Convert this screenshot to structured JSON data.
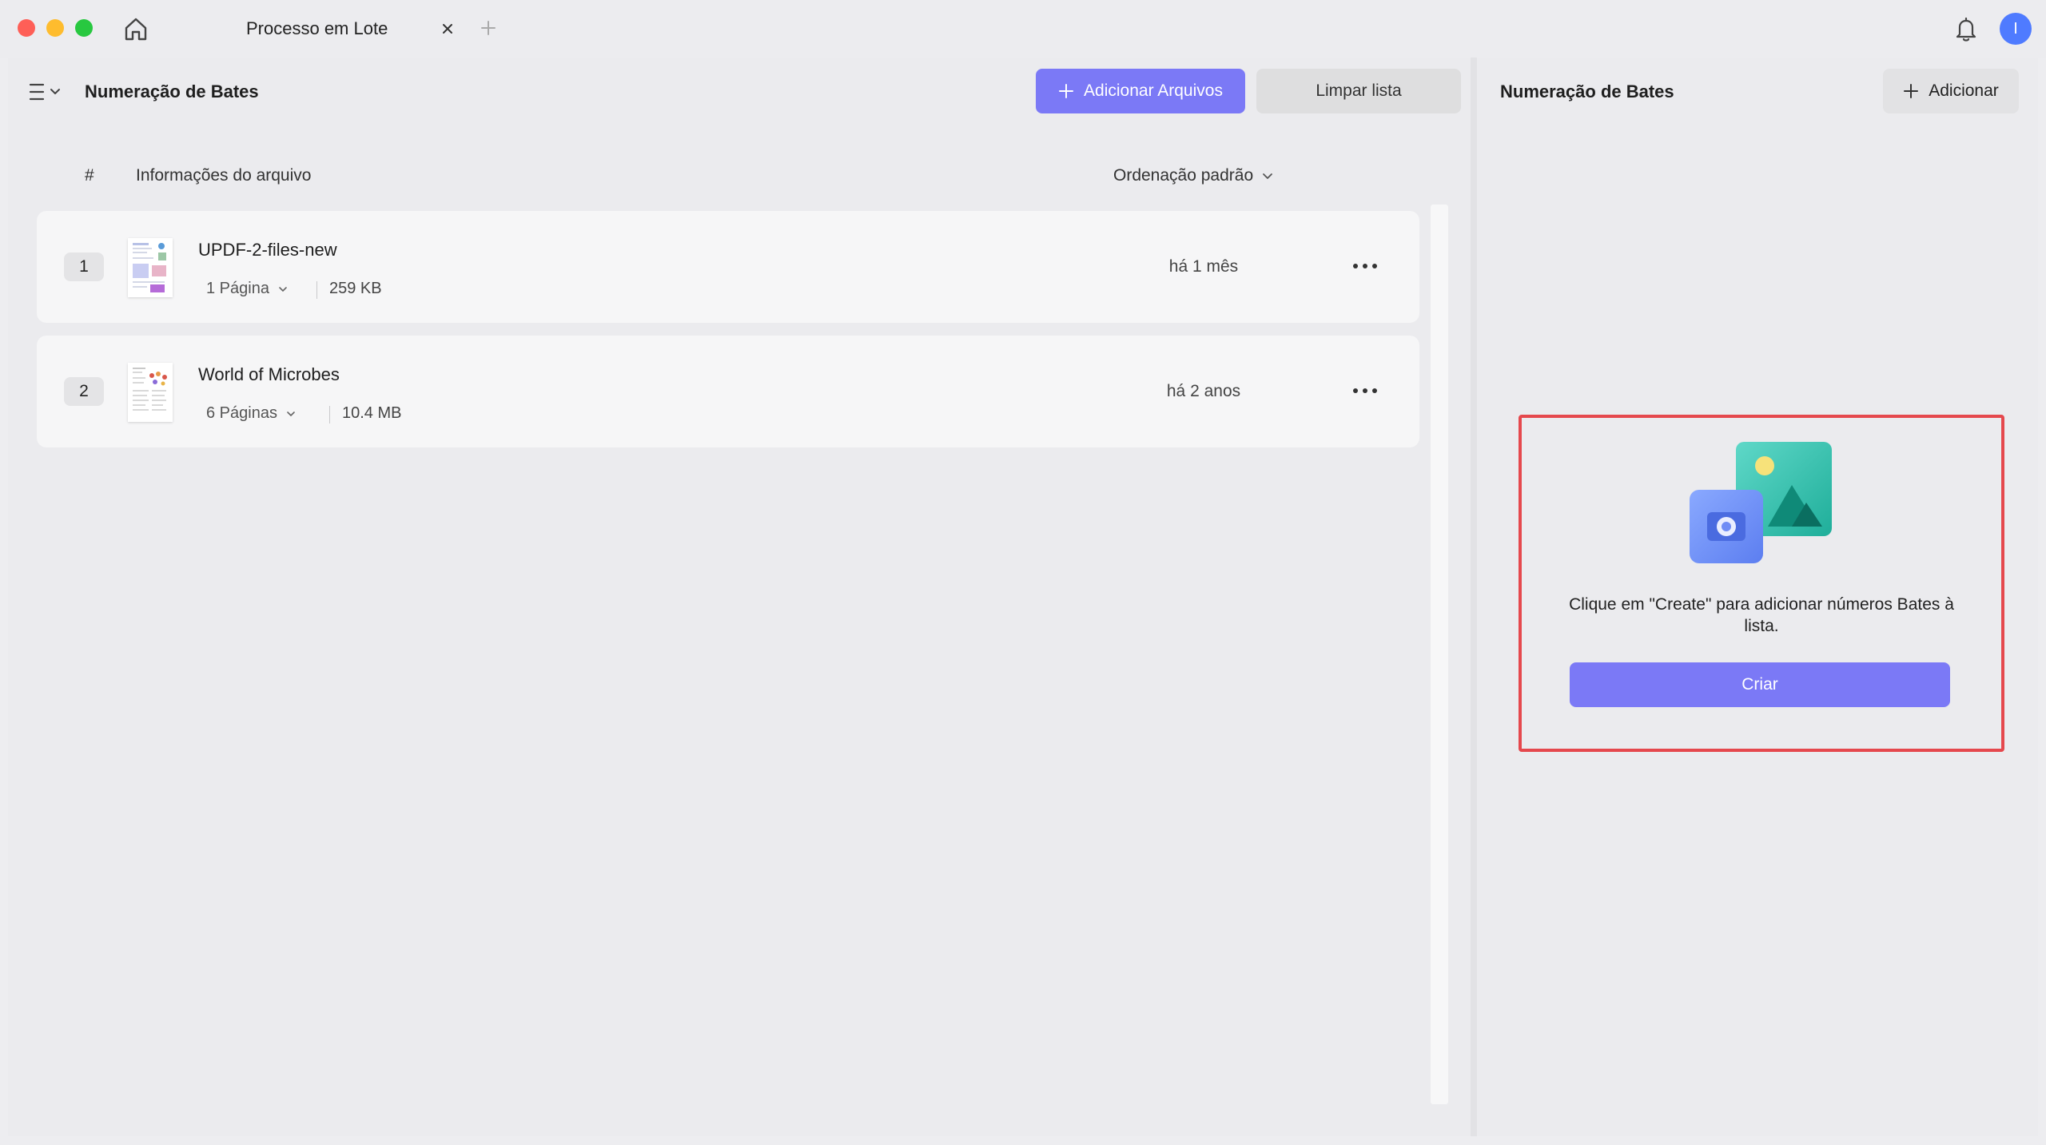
{
  "window": {
    "tab_title": "Processo em Lote",
    "avatar_initial": "I"
  },
  "left": {
    "title": "Numeração de Bates",
    "add_files_label": "Adicionar Arquivos",
    "clear_list_label": "Limpar lista",
    "columns": {
      "hash": "#",
      "info": "Informações do arquivo",
      "sort": "Ordenação padrão"
    },
    "files": [
      {
        "num": "1",
        "name": "UPDF-2-files-new",
        "pages": "1 Página",
        "size": "259 KB",
        "date": "há 1 mês"
      },
      {
        "num": "2",
        "name": "World of Microbes",
        "pages": "6 Páginas",
        "size": "10.4 MB",
        "date": "há 2 anos"
      }
    ]
  },
  "right": {
    "title": "Numeração de Bates",
    "add_label": "Adicionar",
    "empty_message": "Clique em \"Create\" para adicionar números Bates à lista.",
    "create_label": "Criar"
  },
  "colors": {
    "accent": "#7b79f6",
    "highlight_border": "#e5484d"
  }
}
